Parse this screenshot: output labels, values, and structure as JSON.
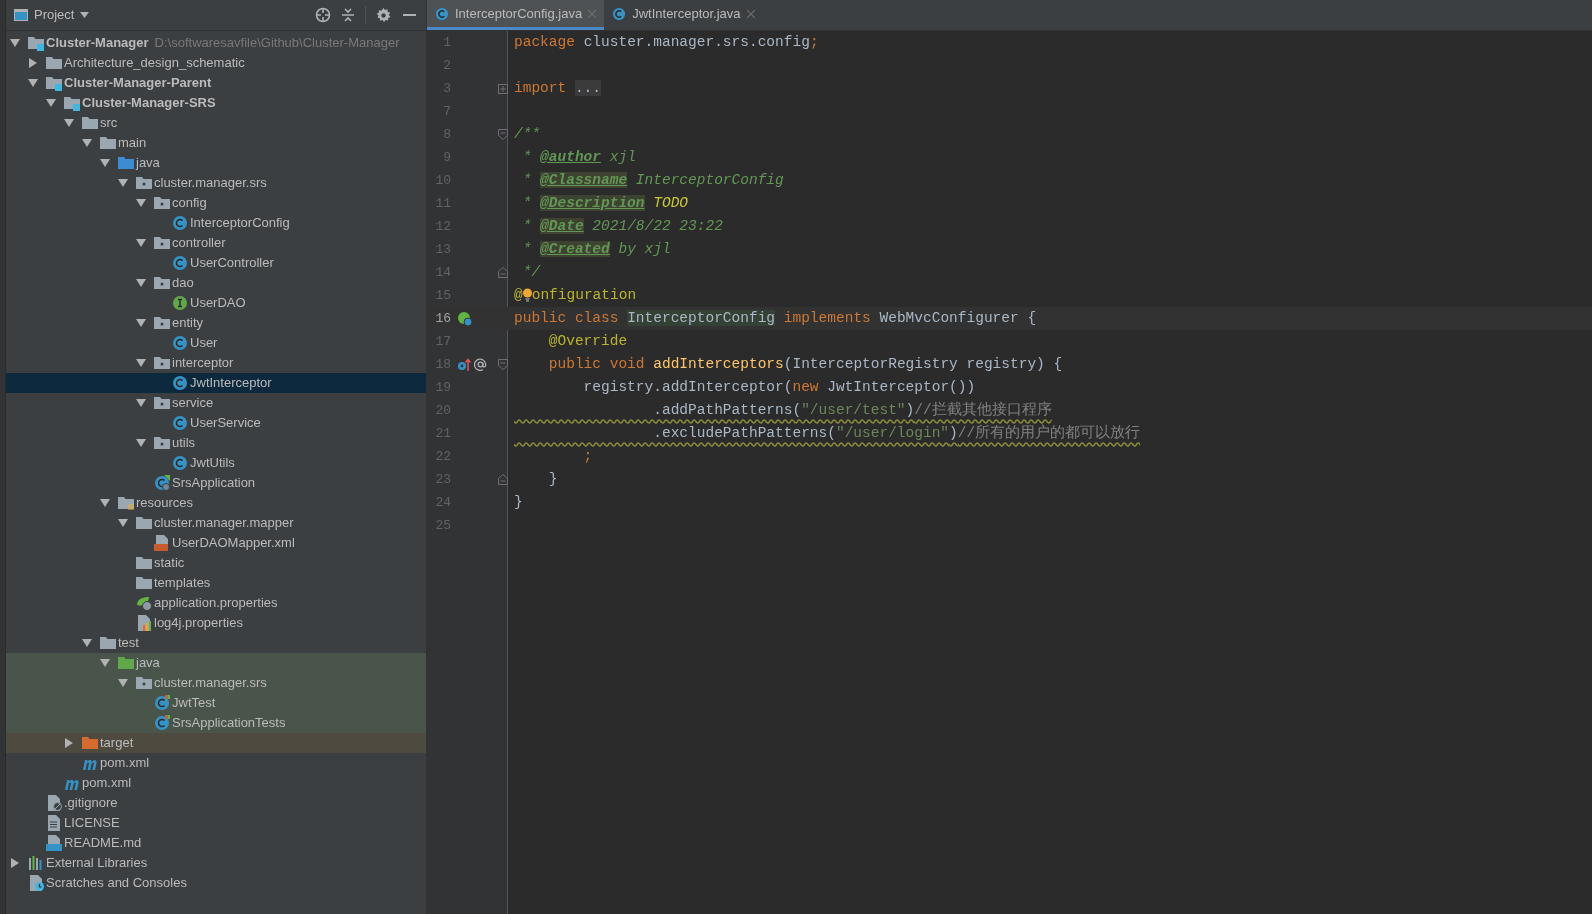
{
  "project_panel": {
    "title": "Project",
    "tree": [
      {
        "label": "Cluster-Manager",
        "kind": "module",
        "path": "D:\\softwaresavfile\\Github\\Cluster-Manager",
        "expanded": true,
        "selected": false,
        "children": [
          {
            "label": "Architecture_design_schematic",
            "kind": "folder",
            "expanded": false,
            "selected": false
          },
          {
            "label": "Cluster-Manager-Parent",
            "kind": "module",
            "expanded": true,
            "selected": false,
            "children": [
              {
                "label": "Cluster-Manager-SRS",
                "kind": "module",
                "expanded": true,
                "selected": false,
                "children": [
                  {
                    "label": "src",
                    "kind": "folder",
                    "expanded": true,
                    "selected": false,
                    "children": [
                      {
                        "label": "main",
                        "kind": "folder",
                        "expanded": true,
                        "selected": false,
                        "children": [
                          {
                            "label": "java",
                            "kind": "source_folder",
                            "expanded": true,
                            "selected": false,
                            "children": [
                              {
                                "label": "cluster.manager.srs",
                                "kind": "package",
                                "expanded": true,
                                "selected": false,
                                "children": [
                                  {
                                    "label": "config",
                                    "kind": "package",
                                    "expanded": true,
                                    "selected": false,
                                    "children": [
                                      {
                                        "label": "InterceptorConfig",
                                        "kind": "class",
                                        "selected": false
                                      }
                                    ]
                                  },
                                  {
                                    "label": "controller",
                                    "kind": "package",
                                    "expanded": true,
                                    "selected": false,
                                    "children": [
                                      {
                                        "label": "UserController",
                                        "kind": "class",
                                        "selected": false
                                      }
                                    ]
                                  },
                                  {
                                    "label": "dao",
                                    "kind": "package",
                                    "expanded": true,
                                    "selected": false,
                                    "children": [
                                      {
                                        "label": "UserDAO",
                                        "kind": "interface",
                                        "selected": false
                                      }
                                    ]
                                  },
                                  {
                                    "label": "entity",
                                    "kind": "package",
                                    "expanded": true,
                                    "selected": false,
                                    "children": [
                                      {
                                        "label": "User",
                                        "kind": "class",
                                        "selected": false
                                      }
                                    ]
                                  },
                                  {
                                    "label": "interceptor",
                                    "kind": "package",
                                    "expanded": true,
                                    "selected": false,
                                    "children": [
                                      {
                                        "label": "JwtInterceptor",
                                        "kind": "class",
                                        "selected": true
                                      }
                                    ]
                                  },
                                  {
                                    "label": "service",
                                    "kind": "package",
                                    "expanded": true,
                                    "selected": false,
                                    "children": [
                                      {
                                        "label": "UserService",
                                        "kind": "class",
                                        "selected": false
                                      }
                                    ]
                                  },
                                  {
                                    "label": "utils",
                                    "kind": "package",
                                    "expanded": true,
                                    "selected": false,
                                    "children": [
                                      {
                                        "label": "JwtUtils",
                                        "kind": "class",
                                        "selected": false
                                      }
                                    ]
                                  },
                                  {
                                    "label": "SrsApplication",
                                    "kind": "spring_class",
                                    "selected": false
                                  }
                                ]
                              }
                            ]
                          },
                          {
                            "label": "resources",
                            "kind": "resources",
                            "expanded": true,
                            "selected": false,
                            "children": [
                              {
                                "label": "cluster.manager.mapper",
                                "kind": "folder",
                                "expanded": true,
                                "selected": false,
                                "children": [
                                  {
                                    "label": "UserDAOMapper.xml",
                                    "kind": "xml",
                                    "selected": false
                                  }
                                ]
                              },
                              {
                                "label": "static",
                                "kind": "folder",
                                "selected": false
                              },
                              {
                                "label": "templates",
                                "kind": "folder",
                                "selected": false
                              },
                              {
                                "label": "application.properties",
                                "kind": "spring_properties",
                                "selected": false
                              },
                              {
                                "label": "log4j.properties",
                                "kind": "properties",
                                "selected": false
                              }
                            ]
                          }
                        ]
                      },
                      {
                        "label": "test",
                        "kind": "folder",
                        "expanded": true,
                        "selected": false,
                        "children": [
                          {
                            "label": "java",
                            "kind": "test_folder",
                            "test_sources": true,
                            "expanded": true,
                            "selected": false,
                            "children": [
                              {
                                "label": "cluster.manager.srs",
                                "kind": "package",
                                "test_sources": true,
                                "expanded": true,
                                "selected": false,
                                "children": [
                                  {
                                    "label": "JwtTest",
                                    "kind": "test_class",
                                    "test_sources": true,
                                    "selected": false
                                  },
                                  {
                                    "label": "SrsApplicationTests",
                                    "kind": "test_class",
                                    "test_sources": true,
                                    "selected": false
                                  }
                                ]
                              }
                            ]
                          }
                        ]
                      }
                    ]
                  },
                  {
                    "label": "target",
                    "kind": "excluded_folder",
                    "excluded": true,
                    "expanded": false,
                    "selected": false
                  },
                  {
                    "label": "pom.xml",
                    "kind": "maven",
                    "selected": false
                  }
                ]
              },
              {
                "label": "pom.xml",
                "kind": "maven",
                "selected": false
              }
            ]
          },
          {
            "label": ".gitignore",
            "kind": "ignore_file",
            "selected": false
          },
          {
            "label": "LICENSE",
            "kind": "text_file",
            "selected": false
          },
          {
            "label": "README.md",
            "kind": "markdown",
            "selected": false
          }
        ]
      },
      {
        "label": "External Libraries",
        "kind": "libraries",
        "expanded": false,
        "selected": false
      },
      {
        "label": "Scratches and Consoles",
        "kind": "scratches",
        "selected": false
      }
    ]
  },
  "editor_tabs": [
    {
      "label": "InterceptorConfig.java",
      "selected": true
    },
    {
      "label": "JwtInterceptor.java",
      "selected": false
    }
  ],
  "code_lines": [
    {
      "number": "1",
      "tokens": [
        {
          "kind": "kw",
          "text": "package "
        },
        {
          "kind": "plain",
          "text": "cluster.manager.srs.config"
        },
        {
          "kind": "kw",
          "text": ";"
        }
      ]
    },
    {
      "number": "2"
    },
    {
      "number": "3",
      "folded": true,
      "tokens": [
        {
          "kind": "kw",
          "text": "import "
        },
        {
          "kind": "folded",
          "text": "..."
        }
      ]
    },
    {
      "number": "7"
    },
    {
      "number": "8",
      "fold_start": true,
      "tokens": [
        {
          "kind": "doc",
          "text": "/**"
        }
      ]
    },
    {
      "number": "9",
      "tokens": [
        {
          "kind": "doc",
          "text": " * "
        },
        {
          "kind": "doctag",
          "text": "@author"
        },
        {
          "kind": "doc",
          "text": " xjl"
        }
      ]
    },
    {
      "number": "10",
      "tokens": [
        {
          "kind": "doc",
          "text": " * "
        },
        {
          "kind": "doctag_hl",
          "text": "@Classname"
        },
        {
          "kind": "doc",
          "text": " InterceptorConfig"
        }
      ]
    },
    {
      "number": "11",
      "tokens": [
        {
          "kind": "doc",
          "text": " * "
        },
        {
          "kind": "doctag_hl",
          "text": "@Description"
        },
        {
          "kind": "todo",
          "text": " TODO"
        }
      ]
    },
    {
      "number": "12",
      "tokens": [
        {
          "kind": "doc",
          "text": " * "
        },
        {
          "kind": "doctag_hl",
          "text": "@Date"
        },
        {
          "kind": "doc",
          "text": " 2021/8/22 23:22"
        }
      ]
    },
    {
      "number": "13",
      "tokens": [
        {
          "kind": "doc",
          "text": " * "
        },
        {
          "kind": "doctag_hl",
          "text": "@Created"
        },
        {
          "kind": "doc",
          "text": " by xjl"
        }
      ]
    },
    {
      "number": "14",
      "fold_end": true,
      "tokens": [
        {
          "kind": "doc",
          "text": " */"
        }
      ]
    },
    {
      "number": "15",
      "tokens": [
        {
          "kind": "annot",
          "text": "@"
        },
        {
          "kind": "bulb"
        },
        {
          "kind": "annot",
          "text": "onfiguration"
        }
      ]
    },
    {
      "number": "16",
      "current": true,
      "bean_marker": true,
      "tokens": [
        {
          "kind": "kw",
          "text": "public class "
        },
        {
          "kind": "ident_hl",
          "text": "InterceptorConfig"
        },
        {
          "kind": "kw",
          "text": " implements "
        },
        {
          "kind": "plain",
          "text": "WebMvcConfigurer {"
        }
      ]
    },
    {
      "number": "17",
      "tokens": [
        {
          "kind": "annot",
          "text": "    @Override"
        }
      ]
    },
    {
      "number": "18",
      "override_marker": true,
      "fold_start": true,
      "tokens": [
        {
          "kind": "kw",
          "text": "    public void "
        },
        {
          "kind": "fn",
          "text": "addInterceptors"
        },
        {
          "kind": "plain",
          "text": "(InterceptorRegistry registry) {"
        }
      ]
    },
    {
      "number": "19",
      "tokens": [
        {
          "kind": "plain",
          "text": "        registry.addInterceptor("
        },
        {
          "kind": "kw",
          "text": "new "
        },
        {
          "kind": "plain",
          "text": "JwtInterceptor())"
        }
      ]
    },
    {
      "number": "20",
      "warning": true,
      "tokens": [
        {
          "kind": "plain",
          "text": "                .addPathPatterns("
        },
        {
          "kind": "str",
          "text": "\"/user/test\""
        },
        {
          "kind": "plain",
          "text": ")"
        },
        {
          "kind": "comment",
          "text": "//拦截其他接口程序"
        }
      ]
    },
    {
      "number": "21",
      "warning": true,
      "tokens": [
        {
          "kind": "plain",
          "text": "                .excludePathPatterns("
        },
        {
          "kind": "str",
          "text": "\"/user/login\""
        },
        {
          "kind": "plain",
          "text": ")"
        },
        {
          "kind": "comment",
          "text": "//所有的用户的都可以放行"
        }
      ]
    },
    {
      "number": "22",
      "tokens": [
        {
          "kind": "kw",
          "text": "        ;"
        }
      ]
    },
    {
      "number": "23",
      "fold_end": true,
      "tokens": [
        {
          "kind": "plain",
          "text": "    }"
        }
      ]
    },
    {
      "number": "24",
      "tokens": [
        {
          "kind": "plain",
          "text": "}"
        }
      ]
    },
    {
      "number": "25"
    }
  ]
}
